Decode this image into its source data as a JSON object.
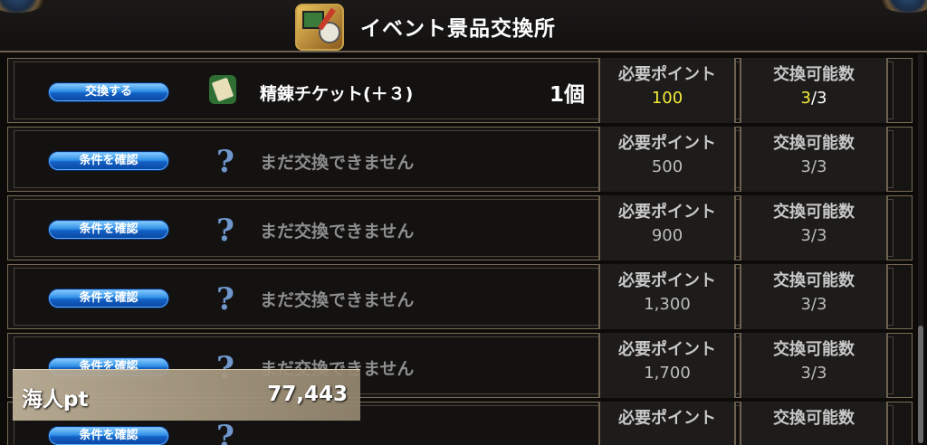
{
  "header": {
    "title": "イベント景品交換所",
    "icon": "event-shop-icon"
  },
  "columns": {
    "required_label": "必要ポイント",
    "available_label": "交換可能数"
  },
  "items": [
    {
      "button": "交換する",
      "name": "精錬チケット(＋３)",
      "qty": "1個",
      "points": "100",
      "available_current": "3",
      "available_rest": "/3",
      "state": "active",
      "icon": "ticket-icon"
    },
    {
      "button": "条件を確認",
      "name": "まだ交換できません",
      "points": "500",
      "available": "3/3",
      "state": "locked",
      "icon": "question-icon"
    },
    {
      "button": "条件を確認",
      "name": "まだ交換できません",
      "points": "900",
      "available": "3/3",
      "state": "locked",
      "icon": "question-icon"
    },
    {
      "button": "条件を確認",
      "name": "まだ交換できません",
      "points": "1,300",
      "available": "3/3",
      "state": "locked",
      "icon": "question-icon"
    },
    {
      "button": "条件を確認",
      "name": "まだ交換できません",
      "points": "1,700",
      "available": "3/3",
      "state": "locked",
      "icon": "question-icon"
    },
    {
      "button": "条件を確認",
      "name": "",
      "points": "",
      "available": "",
      "state": "locked",
      "icon": "question-icon"
    }
  ],
  "points_panel": {
    "label": "海人pt",
    "value": "77,443"
  },
  "colors": {
    "accent_yellow": "#f4ea3a",
    "button_blue": "#1360c4",
    "frame_gold": "#7a6b55"
  }
}
